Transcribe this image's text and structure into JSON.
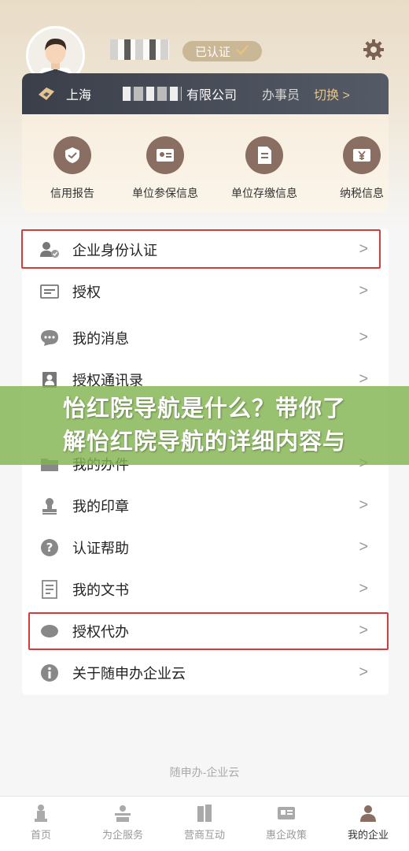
{
  "profile": {
    "verified_label": "已认证",
    "icons": {
      "avatar": "avatar",
      "check": "check-icon",
      "settings": "gear-icon"
    }
  },
  "company": {
    "city": "上海",
    "name_suffix": "有限公司",
    "role": "办事员",
    "switch_label": "切换 >"
  },
  "quick": [
    {
      "label": "信用报告",
      "icon": "shield-check-icon"
    },
    {
      "label": "单位参保信息",
      "icon": "id-card-icon"
    },
    {
      "label": "单位存缴信息",
      "icon": "document-icon"
    },
    {
      "label": "纳税信息",
      "icon": "yen-icon"
    }
  ],
  "menu": [
    {
      "label": "企业身份认证",
      "icon": "user-check-icon"
    },
    {
      "label": "授权",
      "icon": "authorization-icon"
    },
    {
      "label": "我的消息",
      "icon": "message-icon"
    },
    {
      "label": "授权通讯录",
      "icon": "contacts-icon"
    },
    {
      "label": "我的办件",
      "icon": "folder-icon"
    },
    {
      "label": "我的印章",
      "icon": "seal-icon"
    },
    {
      "label": "认证帮助",
      "icon": "help-icon"
    },
    {
      "label": "我的文书",
      "icon": "doc-icon"
    },
    {
      "label": "授权代办",
      "icon": "proxy-icon"
    },
    {
      "label": "关于随申办企业云",
      "icon": "info-icon"
    }
  ],
  "chevron": ">",
  "banner": {
    "line1": "怡红院导航是什么？带你了",
    "line2": "解怡红院导航的详细内容与"
  },
  "footer": "随申办-企业云",
  "tabs": [
    {
      "label": "首页",
      "icon": "home-icon",
      "active": false
    },
    {
      "label": "为企服务",
      "icon": "service-icon",
      "active": false
    },
    {
      "label": "营商互动",
      "icon": "interaction-icon",
      "active": false
    },
    {
      "label": "惠企政策",
      "icon": "policy-icon",
      "active": false
    },
    {
      "label": "我的企业",
      "icon": "my-company-icon",
      "active": true
    }
  ],
  "colors": {
    "accent": "#8a6e61",
    "highlight": "#d43c3c",
    "banner": "#82b450",
    "switch": "#e5c48f"
  }
}
